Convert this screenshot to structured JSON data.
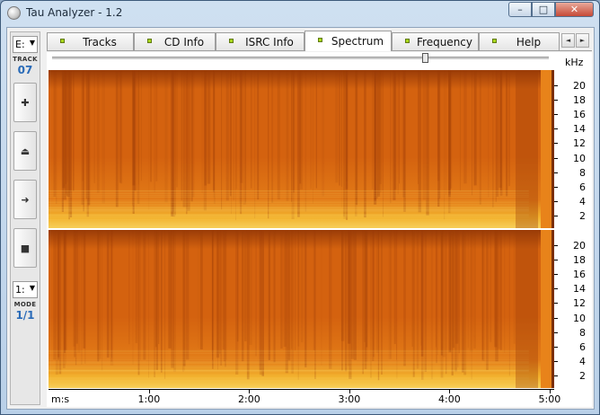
{
  "window": {
    "title": "Tau Analyzer - 1.2"
  },
  "caption_buttons": {
    "minimize": "–",
    "maximize": "□",
    "close": "✕"
  },
  "left_panel": {
    "drive_select": {
      "value": "E:",
      "arrow": "▼"
    },
    "track": {
      "label": "TRACK",
      "value": "07"
    },
    "transport": [
      {
        "name": "play-button",
        "glyph": "✚"
      },
      {
        "name": "eject-button",
        "glyph": "⏏"
      },
      {
        "name": "next-button",
        "glyph": "➜"
      },
      {
        "name": "stop-button",
        "glyph": "■"
      }
    ],
    "mode_select": {
      "value": "1:",
      "arrow": "▼"
    },
    "mode": {
      "label": "MODE",
      "value": "1/1"
    }
  },
  "tabs": [
    {
      "label": "Tracks",
      "active": false
    },
    {
      "label": "CD Info",
      "active": false
    },
    {
      "label": "ISRC Info",
      "active": false
    },
    {
      "label": "Spectrum",
      "active": true
    },
    {
      "label": "Frequency",
      "active": false
    },
    {
      "label": "Help",
      "active": false
    }
  ],
  "tab_scroll": {
    "left": "◄",
    "right": "►"
  },
  "spectrum": {
    "unit_label": "kHz",
    "position_fraction": 0.75,
    "freq_ticks": [
      "20",
      "18",
      "16",
      "14",
      "12",
      "10",
      "8",
      "6",
      "4",
      "2"
    ],
    "time_axis_label": "m:s",
    "time_ticks": [
      "1:00",
      "2:00",
      "3:00",
      "4:00",
      "5:00"
    ],
    "colors": {
      "low": "#f2b12c",
      "mid": "#d4620f",
      "high": "#9a3c08",
      "edge": "#7a2e06"
    }
  }
}
